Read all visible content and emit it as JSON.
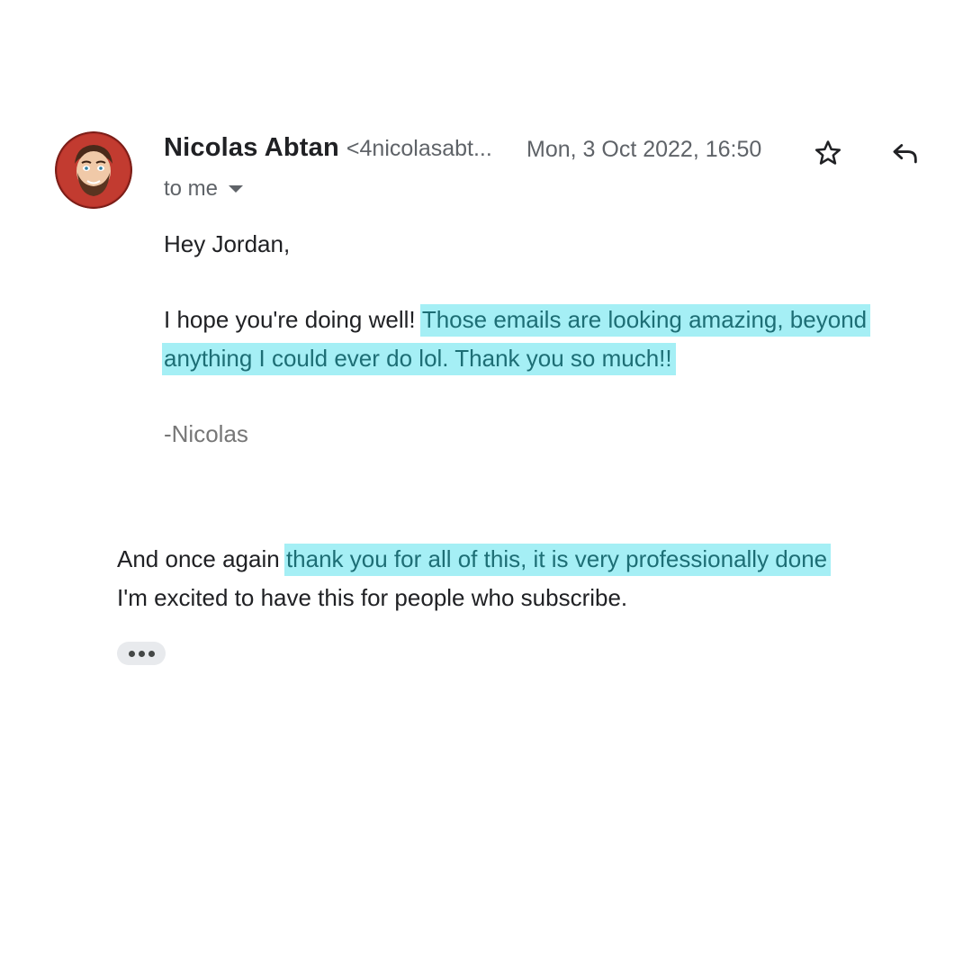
{
  "email": {
    "sender_name": "Nicolas Abtan",
    "sender_email": "<4nicolasabt...",
    "date": "Mon, 3 Oct 2022, 16:50",
    "recipient_label": "to me",
    "greeting": "Hey Jordan,",
    "paragraph_plain": "I hope you're doing well!",
    "paragraph_highlight": "Those emails are looking amazing, beyond anything I could ever do lol. Thank you so much!!",
    "signature": "-Nicolas"
  },
  "follow_up": {
    "plain_start": "And once again",
    "highlight": "thank you for all of this, it is very professionally done",
    "plain_end": "I'm excited to have this for people who subscribe."
  },
  "icons": {
    "star": "star-outline-icon",
    "reply": "reply-icon",
    "caret": "caret-down-icon",
    "more": "more-horizontal-icon"
  },
  "colors": {
    "highlight_bg": "#a5eff5",
    "highlight_text": "#1d6e75",
    "muted_text": "#5f6368",
    "avatar_bg": "#b8322a"
  }
}
